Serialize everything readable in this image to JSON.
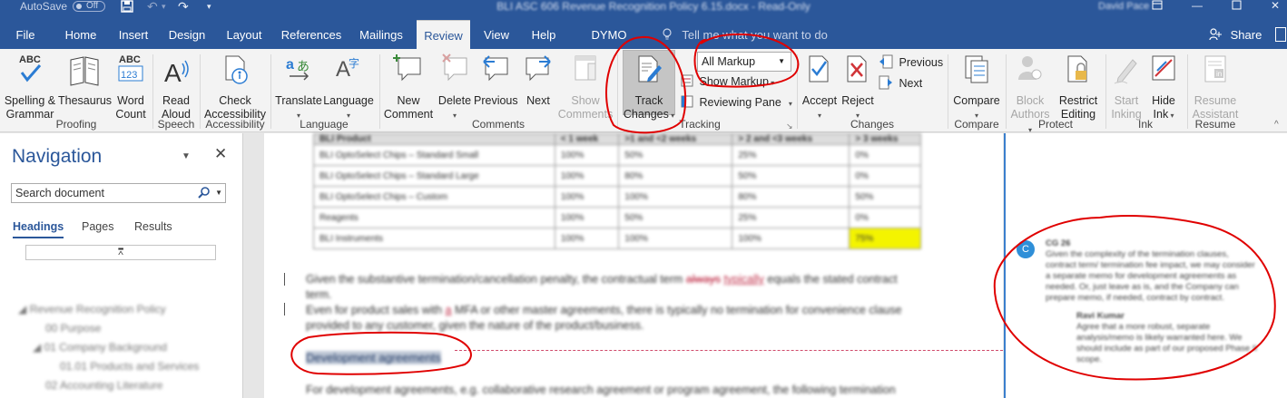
{
  "titlebar": {
    "autosave_label": "AutoSave",
    "autosave_state": "Off",
    "document_title": "BLI ASC 606 Revenue Recognition Policy 6.15.docx - Read-Only",
    "user": "David Pace"
  },
  "tabs": [
    {
      "label": "File"
    },
    {
      "label": "Home"
    },
    {
      "label": "Insert"
    },
    {
      "label": "Design"
    },
    {
      "label": "Layout"
    },
    {
      "label": "References"
    },
    {
      "label": "Mailings"
    },
    {
      "label": "Review"
    },
    {
      "label": "View"
    },
    {
      "label": "Help"
    },
    {
      "label": "DYMO Label"
    }
  ],
  "active_tab": "Review",
  "tell_me": "Tell me what you want to do",
  "share": "Share",
  "ribbon": {
    "proofing": {
      "spelling_1": "Spelling &",
      "spelling_2": "Grammar",
      "thesaurus": "Thesaurus",
      "word_1": "Word",
      "word_2": "Count",
      "group": "Proofing"
    },
    "speech": {
      "read_1": "Read",
      "read_2": "Aloud",
      "group": "Speech"
    },
    "accessibility": {
      "check_1": "Check",
      "check_2": "Accessibility",
      "group": "Accessibility"
    },
    "language": {
      "translate": "Translate",
      "language": "Language",
      "group": "Language"
    },
    "comments": {
      "new_1": "New",
      "new_2": "Comment",
      "delete": "Delete",
      "previous": "Previous",
      "next": "Next",
      "show_1": "Show",
      "show_2": "Comments",
      "group": "Comments"
    },
    "tracking": {
      "track_1": "Track",
      "track_2": "Changes",
      "markup_option": "All Markup",
      "show_markup": "Show Markup",
      "reviewing_pane": "Reviewing Pane",
      "group": "Tracking"
    },
    "changes": {
      "accept": "Accept",
      "reject": "Reject",
      "previous": "Previous",
      "next": "Next",
      "group": "Changes"
    },
    "compare": {
      "compare": "Compare",
      "group": "Compare"
    },
    "protect": {
      "block_1": "Block",
      "block_2": "Authors",
      "restrict_1": "Restrict",
      "restrict_2": "Editing",
      "group": "Protect"
    },
    "ink": {
      "start_1": "Start",
      "start_2": "Inking",
      "hide_1": "Hide",
      "hide_2": "Ink",
      "group": "Ink"
    },
    "resume": {
      "resume_1": "Resume",
      "resume_2": "Assistant",
      "group": "Resume"
    }
  },
  "navigation": {
    "title": "Navigation",
    "search_placeholder": "Search document",
    "tabs": [
      "Headings",
      "Pages",
      "Results"
    ],
    "headings": [
      "Revenue Recognition Policy",
      "00 Purpose",
      "01 Company Background",
      "01.01 Products and Services",
      "02 Accounting Literature"
    ]
  },
  "document": {
    "table_header": [
      "BLI Product",
      "< 1 week",
      ">1 and <2 weeks",
      "> 2 and <3 weeks",
      "> 3 weeks"
    ],
    "table_rows": [
      [
        "BLI OptoSelect Chips – Standard Small",
        "100%",
        "50%",
        "25%",
        "0%"
      ],
      [
        "BLI OptoSelect Chips – Standard Large",
        "100%",
        "80%",
        "50%",
        "0%"
      ],
      [
        "BLI OptoSelect Chips – Custom",
        "100%",
        "100%",
        "80%",
        "50%"
      ],
      [
        "Reagents",
        "100%",
        "50%",
        "25%",
        "0%"
      ],
      [
        "BLI Instruments",
        "100%",
        "100%",
        "100%",
        "75%"
      ]
    ],
    "p1_a": "Given the substantive termination/cancellation penalty, the contractual term ",
    "p1_del": "always",
    "p1_ins": "typically",
    "p1_b": " equals the stated contract",
    "p1_c": "term.",
    "p2_a": "Even for product sales with ",
    "p2_ins": "a",
    "p2_b": " MFA or other master agreements, there is typically no termination for convenience clause",
    "p2_c": "provided to any customer, given the nature of the product/business.",
    "heading": "Development agreements",
    "p3": "For development agreements, e.g. collaborative research agreement or program agreement, the following termination"
  },
  "comment": {
    "avatar": "C",
    "author": "CG 26",
    "lines": [
      "Given the complexity of the termination clauses,",
      "contract term/ termination fee impact, we may consider",
      "a separate memo for development agreements as",
      "needed. Or, just leave as is, and the Company can",
      "prepare memo, if needed, contract by contract."
    ],
    "reply_author": "Ravi Kumar",
    "reply_lines": [
      "Agree that a more robust, separate",
      "analysis/memo is likely warranted here. We",
      "should include as part of our proposed Phase II",
      "scope."
    ]
  }
}
